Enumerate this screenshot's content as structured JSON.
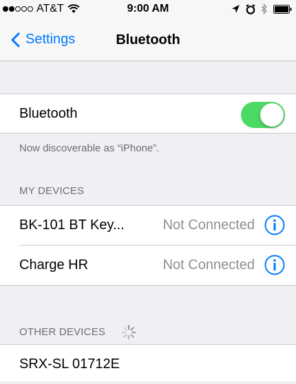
{
  "status_bar": {
    "carrier": "AT&T",
    "time": "9:00 AM",
    "signal_bars_filled": 2,
    "signal_bars_total": 5,
    "icons": [
      "wifi-icon",
      "location-icon",
      "alarm-icon",
      "bluetooth-icon",
      "battery-icon"
    ]
  },
  "nav": {
    "back_label": "Settings",
    "title": "Bluetooth"
  },
  "bluetooth": {
    "label": "Bluetooth",
    "enabled": true,
    "discoverable_text": "Now discoverable as “iPhone”."
  },
  "my_devices": {
    "header": "MY DEVICES",
    "items": [
      {
        "name": "BK-101 BT Key...",
        "status": "Not Connected"
      },
      {
        "name": "Charge HR",
        "status": "Not Connected"
      }
    ]
  },
  "other_devices": {
    "header": "OTHER DEVICES",
    "items": [
      {
        "name": "SRX-SL 01712E"
      }
    ]
  },
  "colors": {
    "accent": "#007aff",
    "toggle_on": "#4cd964",
    "background": "#efeff4",
    "secondary_text": "#8e8e93"
  }
}
